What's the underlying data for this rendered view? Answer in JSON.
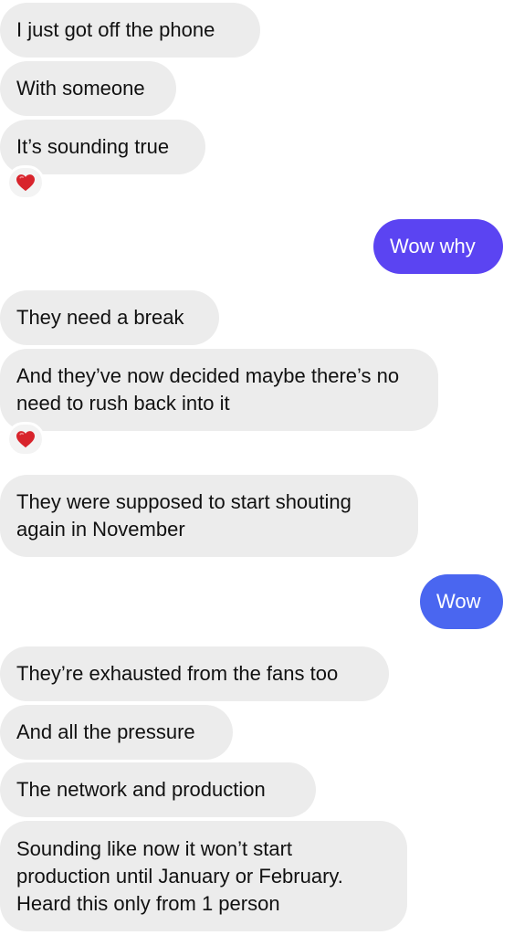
{
  "messages": [
    {
      "side": "incoming",
      "text": "I just got off the phone"
    },
    {
      "side": "incoming",
      "text": "With someone"
    },
    {
      "side": "incoming",
      "text": "It’s sounding true",
      "reaction": "heart-icon"
    },
    {
      "side": "outgoing",
      "text": "Wow why"
    },
    {
      "side": "incoming",
      "text": "They need a break"
    },
    {
      "side": "incoming",
      "text": "And they’ve now decided maybe there’s no need to rush back into it",
      "reaction": "heart-icon"
    },
    {
      "side": "incoming",
      "text": "They were supposed to start shouting again in November"
    },
    {
      "side": "outgoing",
      "text": "Wow"
    },
    {
      "side": "incoming",
      "text": "They’re exhausted from the fans too"
    },
    {
      "side": "incoming",
      "text": "And all the pressure"
    },
    {
      "side": "incoming",
      "text": "The network and production"
    },
    {
      "side": "incoming",
      "text": "Sounding like now it won’t start production until January or February. Heard this only from 1 person"
    }
  ],
  "colors": {
    "incoming_bubble": "#ececec",
    "outgoing_bubble_1": "#5b44f2",
    "outgoing_bubble_2": "#4a66f0",
    "reaction_heart": "#d8242c"
  }
}
